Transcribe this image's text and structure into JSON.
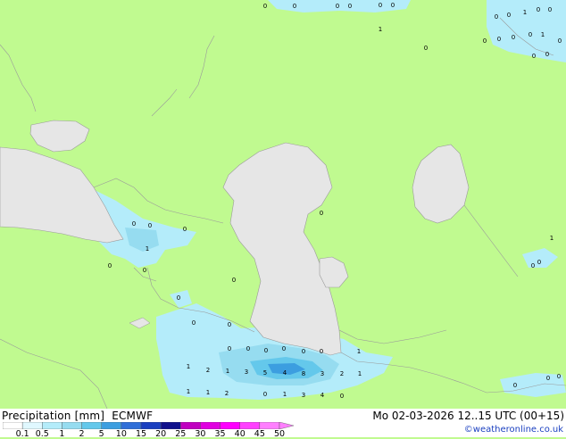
{
  "title": "Precipitation [mm]  ECMWF",
  "datetime": "Mo 02-03-2026 12..15 UTC (00+15)",
  "credit": "©weatheronline.co.uk",
  "legend": {
    "labels": [
      "0.1",
      "0.5",
      "1",
      "2",
      "5",
      "10",
      "15",
      "20",
      "25",
      "30",
      "35",
      "40",
      "45",
      "50"
    ],
    "colors": [
      "#ffffff",
      "#e0f8ff",
      "#b4ecfa",
      "#96dcf0",
      "#64c8eb",
      "#3c9ee0",
      "#2f6ed8",
      "#1a3fc0",
      "#10108c",
      "#c000c0",
      "#e000e0",
      "#ff00ff",
      "#ff40ff",
      "#ff80ff"
    ]
  },
  "colors": {
    "land": "#c0fa90",
    "water": "#e6e6e6",
    "precip_light": "#b4ecfa",
    "precip_medium": "#96dcf0",
    "precip_heavy": "#64c8eb"
  },
  "point_values": [
    "0",
    "0",
    "0",
    "0",
    "0",
    "0",
    "0",
    "1",
    "0",
    "0",
    "0",
    "1",
    "0",
    "1",
    "0",
    "0",
    "0",
    "0",
    "0",
    "0",
    "0",
    "0",
    "0",
    "1",
    "0",
    "0",
    "0",
    "0",
    "0",
    "0",
    "0",
    "0",
    "0",
    "0",
    "1",
    "0",
    "0",
    "0",
    "0",
    "0",
    "1",
    "2",
    "1",
    "3",
    "5",
    "4",
    "8",
    "3",
    "2",
    "1",
    "1",
    "1",
    "1",
    "2",
    "0",
    "1",
    "3",
    "4",
    "0",
    "0",
    "0",
    "0",
    "0"
  ]
}
